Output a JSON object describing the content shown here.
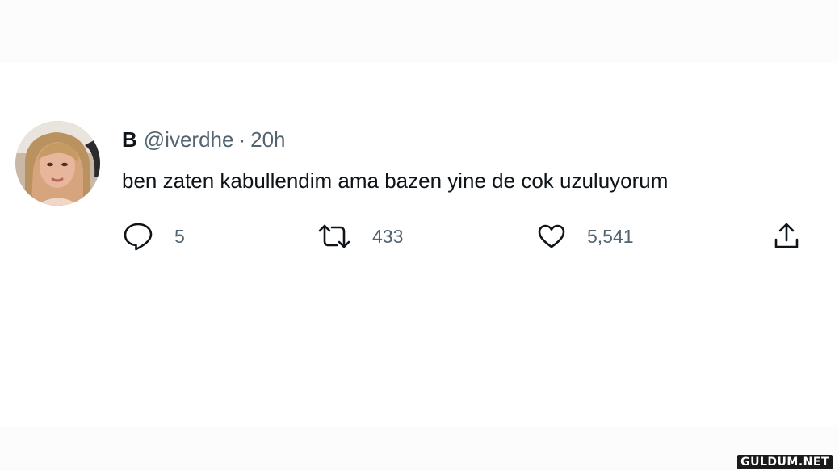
{
  "tweet": {
    "display_name": "B",
    "handle": "@iverdhe",
    "separator": "·",
    "time": "20h",
    "text": "ben zaten kabullendim ama bazen yine de cok uzuluyorum",
    "avatar": "profile-photo"
  },
  "actions": {
    "reply": {
      "icon": "reply-icon",
      "count": "5"
    },
    "retweet": {
      "icon": "retweet-icon",
      "count": "433"
    },
    "like": {
      "icon": "heart-icon",
      "count": "5,541"
    },
    "share": {
      "icon": "share-icon"
    }
  },
  "watermark": "GULDUM.NET",
  "colors": {
    "text_primary": "#0f1419",
    "text_secondary": "#536471",
    "background": "#ffffff"
  }
}
